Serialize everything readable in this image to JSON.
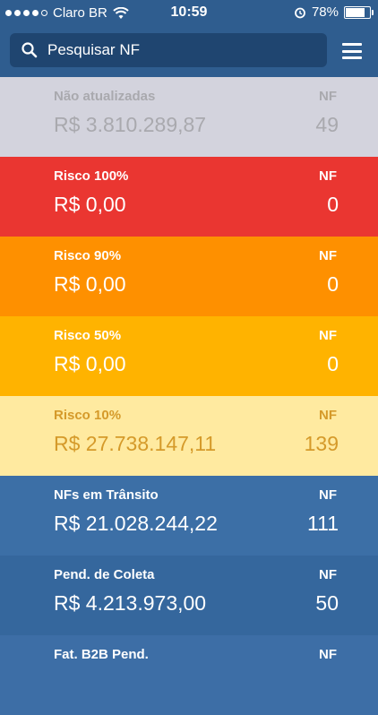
{
  "status_bar": {
    "carrier": "Claro BR",
    "time": "10:59",
    "battery": "78%",
    "signal_bars": 4
  },
  "search": {
    "placeholder": "Pesquisar NF"
  },
  "rows": [
    {
      "label": "Não atualizadas",
      "value": "R$ 3.810.289,87",
      "nf_label": "NF",
      "count": "49",
      "bg": "#d3d3dd",
      "text": "gray"
    },
    {
      "label": "Risco 100%",
      "value": "R$ 0,00",
      "nf_label": "NF",
      "count": "0",
      "bg": "#ea3631",
      "text": "white"
    },
    {
      "label": "Risco 90%",
      "value": "R$ 0,00",
      "nf_label": "NF",
      "count": "0",
      "bg": "#fe9000",
      "text": "white"
    },
    {
      "label": "Risco 50%",
      "value": "R$ 0,00",
      "nf_label": "NF",
      "count": "0",
      "bg": "#ffb300",
      "text": "white"
    },
    {
      "label": "Risco 10%",
      "value": "R$ 27.738.147,11",
      "nf_label": "NF",
      "count": "139",
      "bg": "#ffeaa0",
      "text": "amber"
    },
    {
      "label": "NFs em Trânsito",
      "value": "R$ 21.028.244,22",
      "nf_label": "NF",
      "count": "111",
      "bg": "#3c6fa6",
      "text": "white"
    },
    {
      "label": "Pend. de Coleta",
      "value": "R$ 4.213.973,00",
      "nf_label": "NF",
      "count": "50",
      "bg": "#35679d",
      "text": "white"
    },
    {
      "label": "Fat. B2B Pend.",
      "value": "",
      "nf_label": "NF",
      "count": "",
      "bg": "#3d6ea6",
      "text": "white"
    }
  ]
}
